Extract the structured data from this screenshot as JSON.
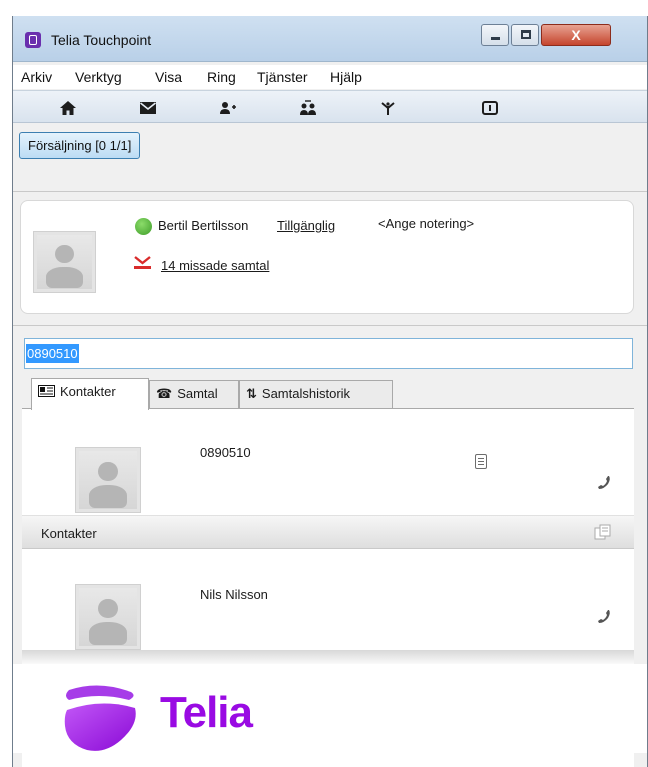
{
  "window": {
    "title": "Telia Touchpoint",
    "close_glyph": "X"
  },
  "menu": [
    "Arkiv",
    "Verktyg",
    "Visa",
    "Ring",
    "Tjänster",
    "Hjälp"
  ],
  "toolbar_icons": [
    "home-icon",
    "mail-icon",
    "add-contact-icon",
    "transfer-icon",
    "split-icon",
    "calendar-icon"
  ],
  "queue": {
    "label": "Försäljning [0 1/1]"
  },
  "profile": {
    "name": "Bertil Bertilsson",
    "status": "Tillgänglig",
    "note": "<Ange notering>",
    "missed": "14 missade samtal",
    "status_color": "#4caf36"
  },
  "search": {
    "value": "0890510"
  },
  "tabs": [
    {
      "label": "Kontakter",
      "icon": "contacts-card-icon"
    },
    {
      "label": "Samtal",
      "icon": "phone-icon"
    },
    {
      "label": "Samtalshistorik",
      "icon": "history-icon"
    }
  ],
  "results": {
    "number_entry": "0890510",
    "section_title": "Kontakter",
    "contacts": [
      "Nils Nilsson"
    ]
  },
  "brand": {
    "name": "Telia",
    "color": "#990ae3"
  }
}
